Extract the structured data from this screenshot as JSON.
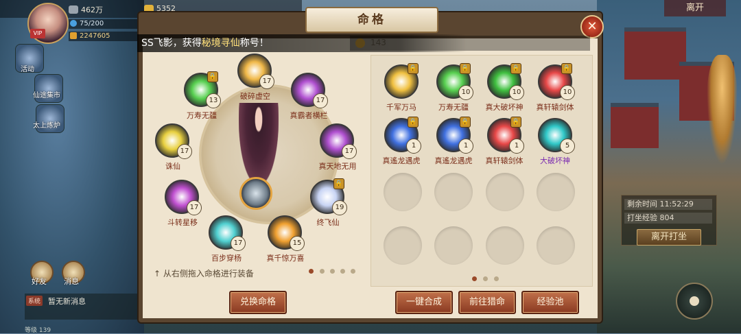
{
  "top_bar": {
    "resource1": "462万",
    "resource2": "5352",
    "stamina": "75/200",
    "combat_power": "2247605",
    "vip": "VIP"
  },
  "left_side": {
    "items": [
      {
        "label": "活动"
      },
      {
        "label": "仙途集市"
      },
      {
        "label": "太上炼炉"
      }
    ],
    "friends_label": "好友",
    "messages_label": "消息",
    "chat_tag": "系统",
    "chat_message": "暂无新消息",
    "level_label": "等级 139"
  },
  "right_side": {
    "leave_label": "离开",
    "remaining_time": "剩余时间 11:52:29",
    "meditate_exp": "打坐经验 804",
    "leave_meditate_label": "离开打坐"
  },
  "panel": {
    "title": "命格",
    "close_icon": "close-icon",
    "announcement_prefix": "SS飞影，获得",
    "announcement_highlight": "秘境寻仙",
    "announcement_suffix": "称号！",
    "gold_value": "143",
    "equipped": [
      {
        "name": "破碎虚空",
        "level": "17",
        "color": "#f0b848",
        "locked": false
      },
      {
        "name": "真霸者横栏",
        "level": "17",
        "color": "#b050d0",
        "locked": false
      },
      {
        "name": "真天地无用",
        "level": "17",
        "color": "#b050d0",
        "locked": false
      },
      {
        "name": "终飞仙",
        "level": "19",
        "color": "#c8d4f4",
        "locked": true
      },
      {
        "name": "真千惊万喜",
        "level": "15",
        "color": "#f0a030",
        "locked": false
      },
      {
        "name": "百步穿杨",
        "level": "17",
        "color": "#50d0d0",
        "locked": false
      },
      {
        "name": "斗转星移",
        "level": "17",
        "color": "#c050d0",
        "locked": false
      },
      {
        "name": "诛仙",
        "level": "17",
        "color": "#e8d040",
        "locked": false
      },
      {
        "name": "万寿无疆",
        "level": "13",
        "color": "#58d050",
        "locked": true
      }
    ],
    "hint": "↑ 从右侧拖入命格进行装备",
    "exchange_label": "兑换命格",
    "inventory": [
      {
        "name": "千军万马",
        "level": "",
        "color": "#f0c040",
        "locked": true,
        "purple": false
      },
      {
        "name": "万寿无疆",
        "level": "10",
        "color": "#58d050",
        "locked": true,
        "purple": false
      },
      {
        "name": "真大破坏神",
        "level": "10",
        "color": "#40c040",
        "locked": true,
        "purple": false
      },
      {
        "name": "真轩辕剑体",
        "level": "10",
        "color": "#e84848",
        "locked": true,
        "purple": false
      },
      {
        "name": "真遙龙遇虎",
        "level": "1",
        "color": "#4070e0",
        "locked": true,
        "purple": false
      },
      {
        "name": "真遙龙遇虎",
        "level": "1",
        "color": "#4070e0",
        "locked": true,
        "purple": false
      },
      {
        "name": "真轩辕剑体",
        "level": "1",
        "color": "#e84848",
        "locked": true,
        "purple": false
      },
      {
        "name": "大破坏神",
        "level": "5",
        "color": "#30c8c8",
        "locked": false,
        "purple": true
      }
    ],
    "one_click_merge_label": "一键合成",
    "go_hunt_label": "前往猎命",
    "exp_pool_label": "经验池"
  }
}
